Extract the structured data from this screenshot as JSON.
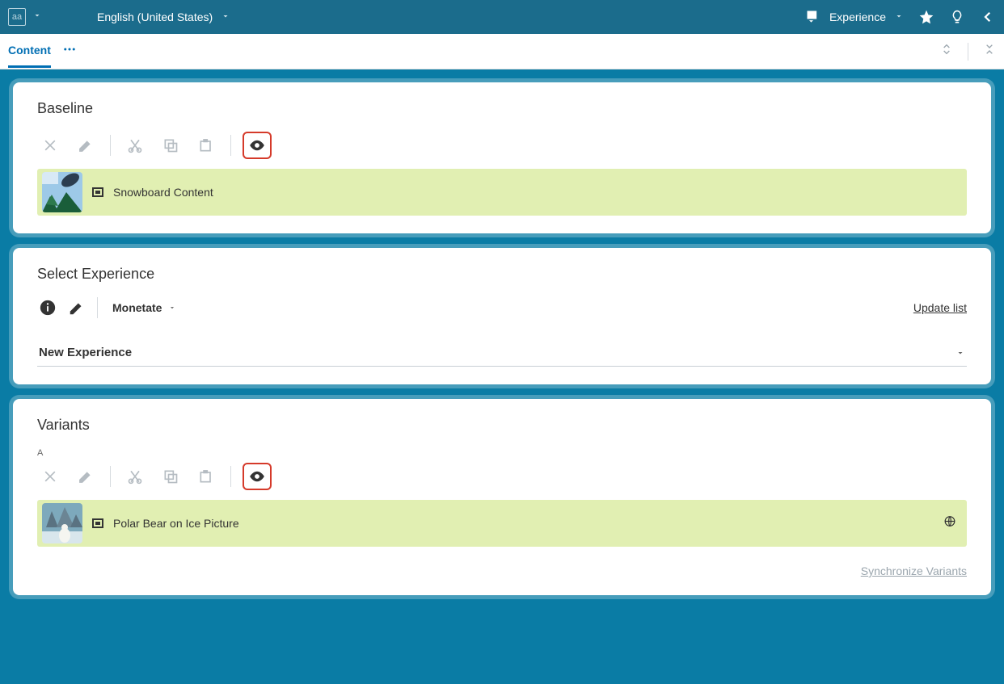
{
  "topbar": {
    "logo_text": "aa",
    "language": "English (United States)",
    "experience_label": "Experience"
  },
  "tabbar": {
    "content_tab": "Content"
  },
  "baseline": {
    "title": "Baseline",
    "item_label": "Snowboard Content"
  },
  "select_experience": {
    "title": "Select Experience",
    "provider": "Monetate",
    "update_link": "Update list",
    "field_label": "New Experience"
  },
  "variants": {
    "title": "Variants",
    "variant_letter": "A",
    "item_label": "Polar Bear on Ice Picture",
    "sync_link": "Synchronize Variants"
  }
}
